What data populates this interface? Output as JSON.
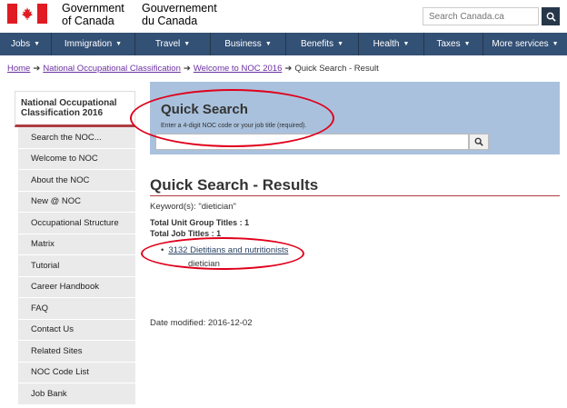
{
  "header": {
    "gov_en_line1": "Government",
    "gov_en_line2": "of Canada",
    "gov_fr_line1": "Gouvernement",
    "gov_fr_line2": "du Canada",
    "search_placeholder": "Search Canada.ca",
    "search_icon": "magnifier-icon"
  },
  "nav": {
    "items": [
      {
        "label": "Jobs"
      },
      {
        "label": "Immigration"
      },
      {
        "label": "Travel"
      },
      {
        "label": "Business"
      },
      {
        "label": "Benefits"
      },
      {
        "label": "Health"
      },
      {
        "label": "Taxes"
      },
      {
        "label": "More services"
      }
    ]
  },
  "breadcrumb": {
    "home": "Home",
    "noc": "National Occupational Classification",
    "welcome": "Welcome to NOC 2016",
    "current": "Quick Search - Result"
  },
  "sidebar": {
    "heading": "National Occupational Classification 2016",
    "items": [
      {
        "label": "Search the NOC..."
      },
      {
        "label": "Welcome to NOC"
      },
      {
        "label": "About the NOC"
      },
      {
        "label": "New @ NOC"
      },
      {
        "label": "Occupational Structure"
      },
      {
        "label": "Matrix"
      },
      {
        "label": "Tutorial"
      },
      {
        "label": "Career Handbook"
      },
      {
        "label": "FAQ"
      },
      {
        "label": "Contact Us"
      },
      {
        "label": "Related Sites"
      },
      {
        "label": "NOC Code List"
      },
      {
        "label": "Job Bank"
      }
    ]
  },
  "quick_search": {
    "title": "Quick Search",
    "hint": "Enter a 4-digit NOC code or your job title (required).",
    "input_value": ""
  },
  "results": {
    "title": "Quick Search - Results",
    "keyword": "Keyword(s): \"dietician\"",
    "total_unit_groups": "Total Unit Group Titles : 1",
    "total_job_titles": "Total Job Titles : 1",
    "result_link": "3132 Dietitians and nutritionists",
    "result_sub": "dietician",
    "date_modified": "Date modified: 2016-12-02"
  },
  "colors": {
    "nav_bg": "#335075",
    "panel_bg": "#a9c1dc",
    "accent_red": "#af3c43",
    "annotation_red": "#e0001b"
  }
}
